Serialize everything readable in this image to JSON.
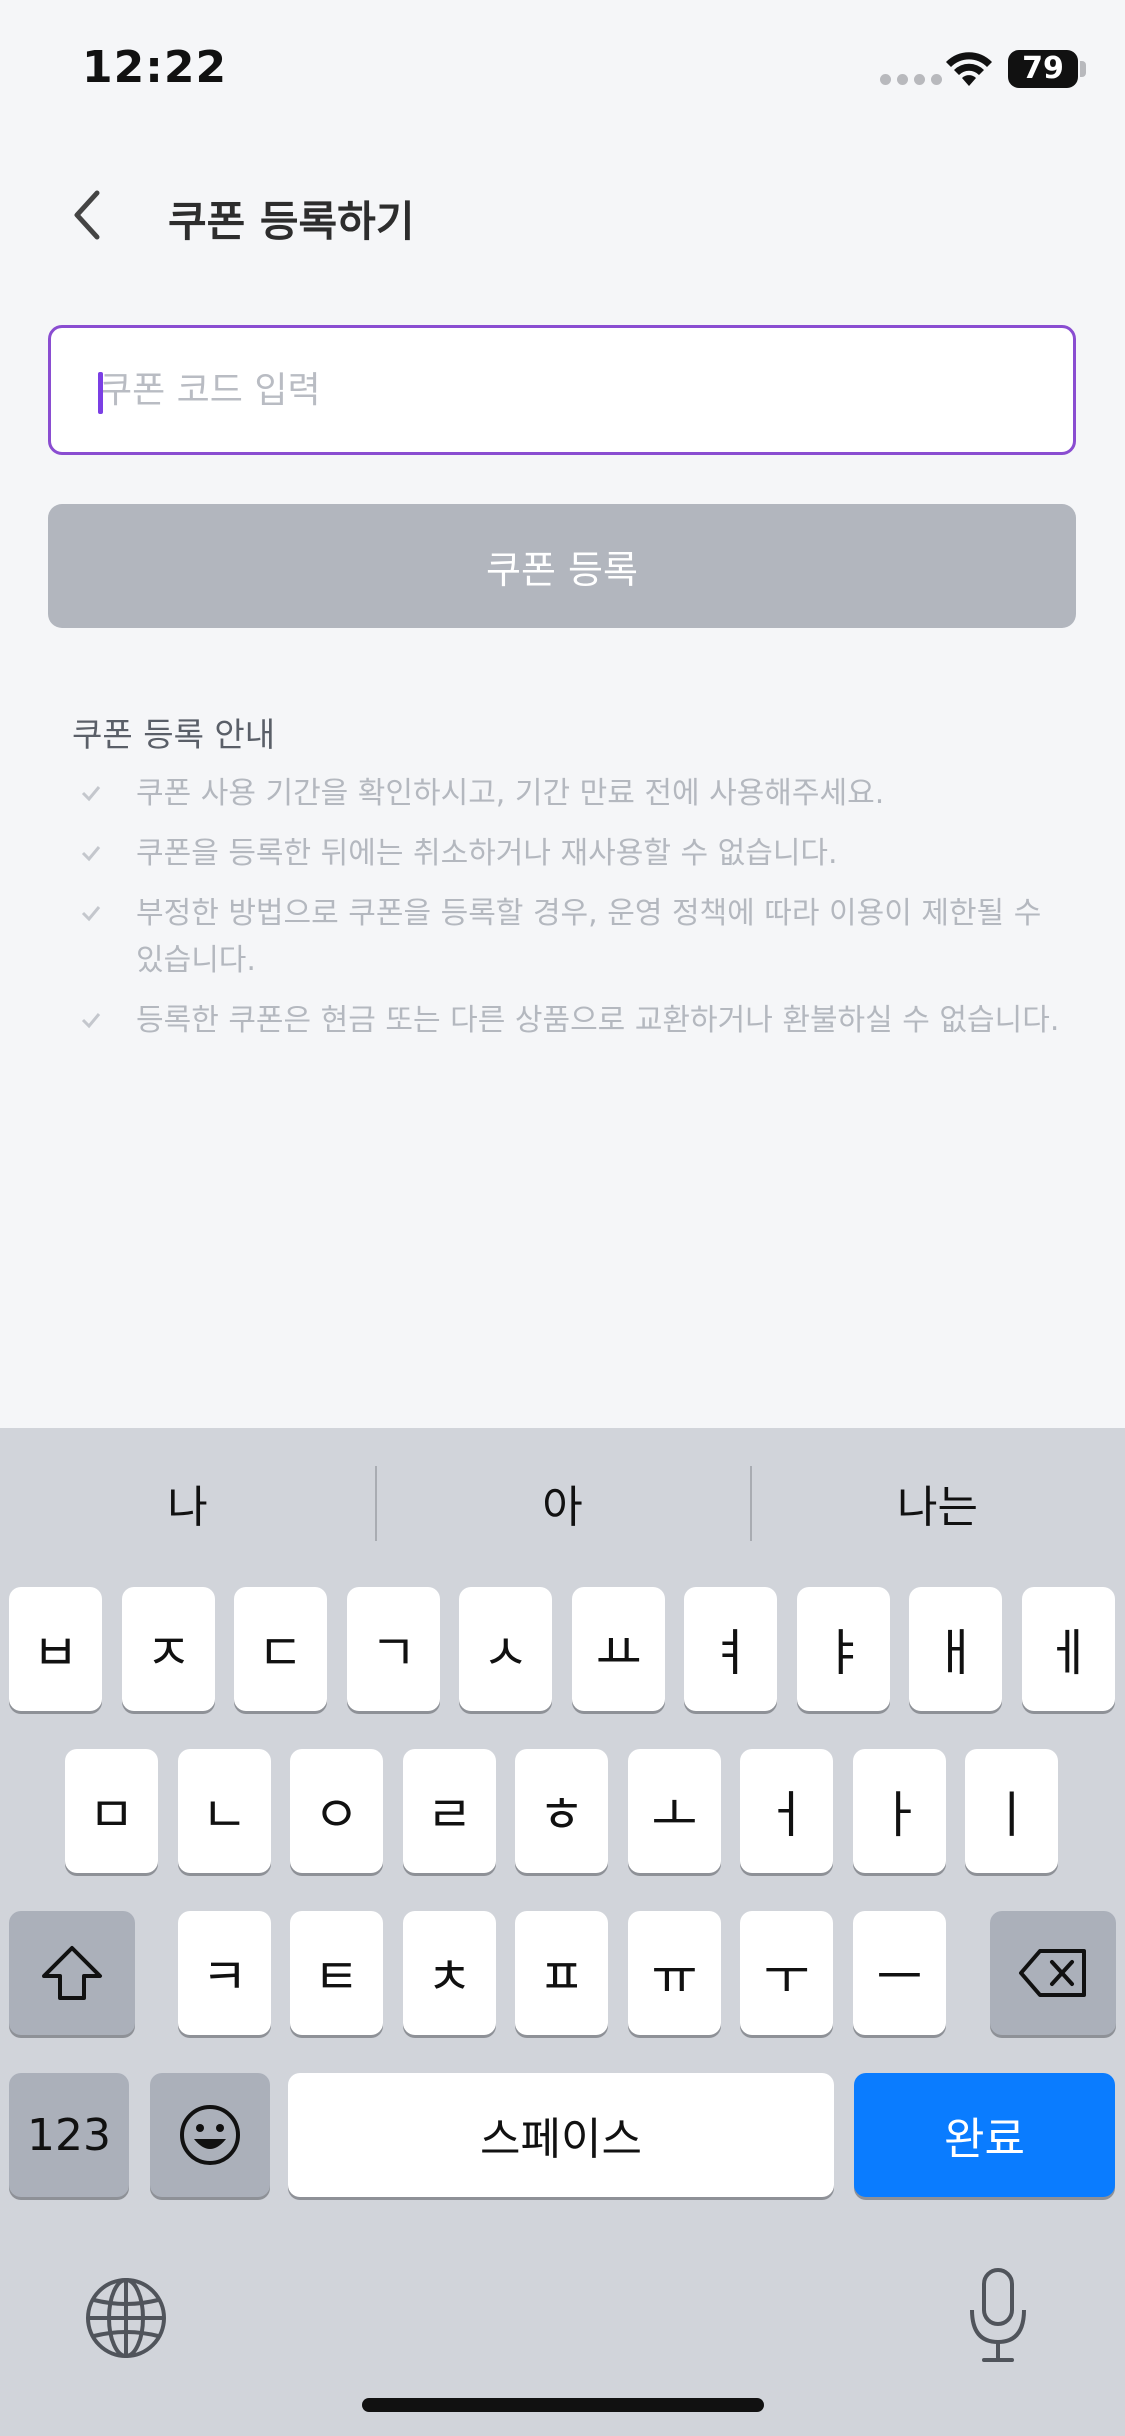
{
  "status_bar": {
    "time": "12:22",
    "battery": "79"
  },
  "header": {
    "title": "쿠폰 등록하기",
    "back_icon": "chevron-left-icon"
  },
  "coupon": {
    "placeholder": "쿠폰 코드 입력",
    "value": "",
    "button_label": "쿠폰 등록"
  },
  "notice": {
    "title": "쿠폰 등록 안내",
    "items": [
      "쿠폰 사용 기간을 확인하시고, 기간 만료 전에 사용해주세요.",
      "쿠폰을 등록한 뒤에는 취소하거나 재사용할 수 없습니다.",
      "부정한 방법으로 쿠폰을 등록할 경우, 운영 정책에 따라 이용이 제한될 수 있습니다.",
      "등록한 쿠폰은 현금 또는 다른 상품으로 교환하거나 환불하실 수 없습니다."
    ]
  },
  "keyboard": {
    "suggestions": [
      "나",
      "아",
      "나는"
    ],
    "row1": [
      "ㅂ",
      "ㅈ",
      "ㄷ",
      "ㄱ",
      "ㅅ",
      "ㅛ",
      "ㅕ",
      "ㅑ",
      "ㅐ",
      "ㅔ"
    ],
    "row2": [
      "ㅁ",
      "ㄴ",
      "ㅇ",
      "ㄹ",
      "ㅎ",
      "ㅗ",
      "ㅓ",
      "ㅏ",
      "ㅣ"
    ],
    "row3": [
      "ㅋ",
      "ㅌ",
      "ㅊ",
      "ㅍ",
      "ㅠ",
      "ㅜ",
      "ㅡ"
    ],
    "numbers_label": "123",
    "space_label": "스페이스",
    "done_label": "완료"
  },
  "colors": {
    "accent": "#8a4dd1",
    "button_disabled": "#b2b6be",
    "keyboard_bg": "#d1d4da",
    "done_key": "#0a7cff"
  }
}
